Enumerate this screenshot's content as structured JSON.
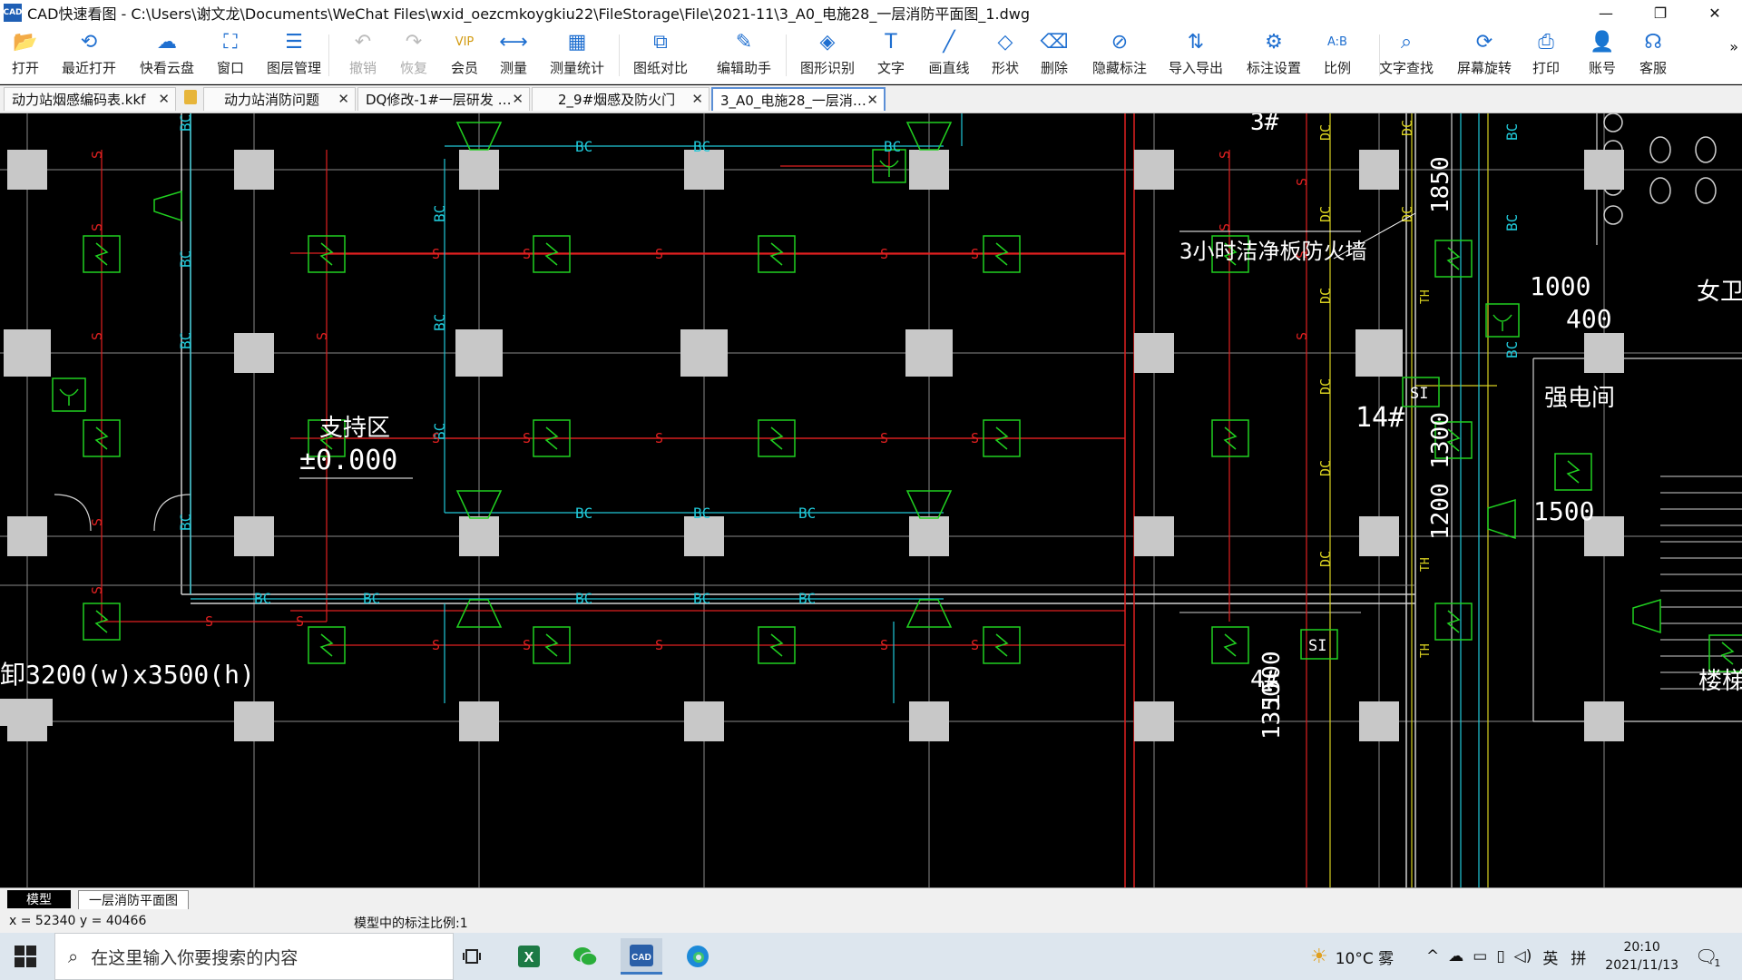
{
  "window": {
    "app_icon": "CAD",
    "title": "CAD快速看图 - C:\\Users\\谢文龙\\Documents\\WeChat Files\\wxid_oezcmkoygkiu22\\FileStorage\\File\\2021-11\\3_A0_电施28_一层消防平面图_1.dwg",
    "minimize": "—",
    "restore": "❐",
    "close": "✕"
  },
  "toolbar": {
    "items": [
      {
        "label": "打开",
        "icon": "folder-open-icon",
        "glyph": "📂"
      },
      {
        "label": "最近打开",
        "icon": "history-icon",
        "glyph": "⟲"
      },
      {
        "label": "快看云盘",
        "icon": "cloud-icon",
        "glyph": "☁"
      },
      {
        "label": "窗口",
        "icon": "window-icon",
        "glyph": "⛶"
      },
      {
        "label": "图层管理",
        "icon": "layers-icon",
        "glyph": "☰"
      },
      {
        "label": "撤销",
        "icon": "undo-icon",
        "glyph": "↶"
      },
      {
        "label": "恢复",
        "icon": "redo-icon",
        "glyph": "↷"
      },
      {
        "label": "会员",
        "icon": "vip-icon",
        "glyph": "VIP"
      },
      {
        "label": "测量",
        "icon": "ruler-icon",
        "glyph": "⟷"
      },
      {
        "label": "测量统计",
        "icon": "measure-stats-icon",
        "glyph": "▦"
      },
      {
        "label": "图纸对比",
        "icon": "compare-icon",
        "glyph": "⧉"
      },
      {
        "label": "编辑助手",
        "icon": "edit-assistant-icon",
        "glyph": "✎"
      },
      {
        "label": "图形识别",
        "icon": "shape-recognition-icon",
        "glyph": "◈"
      },
      {
        "label": "文字",
        "icon": "text-icon",
        "glyph": "T"
      },
      {
        "label": "画直线",
        "icon": "line-icon",
        "glyph": "╱"
      },
      {
        "label": "形状",
        "icon": "shape-icon",
        "glyph": "◇"
      },
      {
        "label": "删除",
        "icon": "eraser-icon",
        "glyph": "⌫"
      },
      {
        "label": "隐藏标注",
        "icon": "hide-annotation-icon",
        "glyph": "⊘"
      },
      {
        "label": "导入导出",
        "icon": "import-export-icon",
        "glyph": "⇅"
      },
      {
        "label": "标注设置",
        "icon": "annotation-settings-icon",
        "glyph": "⚙"
      },
      {
        "label": "比例",
        "icon": "scale-icon",
        "glyph": "A:B"
      },
      {
        "label": "文字查找",
        "icon": "text-search-icon",
        "glyph": "⌕"
      },
      {
        "label": "屏幕旋转",
        "icon": "rotate-screen-icon",
        "glyph": "⟳"
      },
      {
        "label": "打印",
        "icon": "print-icon",
        "glyph": "⎙"
      },
      {
        "label": "账号",
        "icon": "account-icon",
        "glyph": "👤"
      },
      {
        "label": "客服",
        "icon": "headset-icon",
        "glyph": "☊"
      }
    ],
    "more": "»"
  },
  "tabs": [
    {
      "label": "动力站烟感编码表.kkf",
      "close": "✕"
    },
    {
      "label": "动力站消防问题",
      "close": "✕"
    },
    {
      "label": "DQ修改-1#一层研发 …",
      "close": "✕"
    },
    {
      "label": "2_9#烟感及防火门",
      "close": "✕"
    },
    {
      "label": "3_A0_电施28_一层消…",
      "close": "✕"
    }
  ],
  "drawing": {
    "labels": {
      "room_fire_wall": "3小时洁净板防火墙",
      "support_area": "支持区",
      "elevation": "±0.000",
      "door_size": "卸3200(w)x3500(h)",
      "strong_electric_room": "强电间",
      "stair": "楼梯",
      "female_wc": "女卫",
      "axis_3": "3#",
      "axis_14": "14#",
      "axis_4": "4#",
      "dim_1000": "1000",
      "dim_400": "400",
      "dim_1500": "1500",
      "dim_1850": "1850",
      "dim_1200_1300": "1200 1300",
      "dim_1500b": "1500",
      "dim_1350": "1350",
      "si": "SI",
      "bc": "BC",
      "s": "S",
      "dc": "DC",
      "th": "TH"
    },
    "colors": {
      "red_line": "#e02020",
      "cyan_line": "#20c8d8",
      "green_symbol": "#20d020",
      "yellow_line": "#d8d020",
      "grid_line": "#8a8a8a",
      "column": "#c8c8c8",
      "white_line": "#d0d0d0"
    }
  },
  "layout_tabs": [
    {
      "label": "模型",
      "active": true
    },
    {
      "label": "一层消防平面图",
      "active": false
    }
  ],
  "status": {
    "coords": "x = 52340  y = 40466",
    "scale": "模型中的标注比例:1"
  },
  "taskbar": {
    "search_placeholder": "在这里输入你要搜索的内容",
    "weather": "10°C 雾",
    "ime": "英",
    "ime2": "拼",
    "time": "20:10",
    "date": "2021/11/13",
    "notification": "1"
  }
}
